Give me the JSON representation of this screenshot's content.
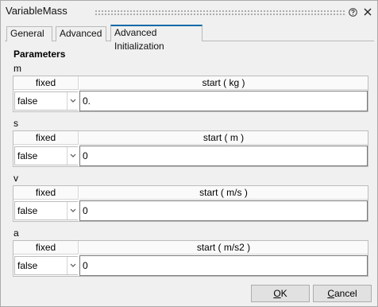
{
  "window": {
    "title": "VariableMass"
  },
  "tabs": [
    {
      "label": "General"
    },
    {
      "label": "Advanced"
    },
    {
      "label": "Advanced Initialization",
      "active": true
    }
  ],
  "section_title": "Parameters",
  "parameters": [
    {
      "name": "m",
      "fixed_header": "fixed",
      "start_header": "start ( kg )",
      "fixed_value": "false",
      "start_value": "0."
    },
    {
      "name": "s",
      "fixed_header": "fixed",
      "start_header": "start ( m )",
      "fixed_value": "false",
      "start_value": "0"
    },
    {
      "name": "v",
      "fixed_header": "fixed",
      "start_header": "start ( m/s )",
      "fixed_value": "false",
      "start_value": "0"
    },
    {
      "name": "a",
      "fixed_header": "fixed",
      "start_header": "start ( m/s2 )",
      "fixed_value": "false",
      "start_value": "0"
    }
  ],
  "buttons": {
    "ok_mnemonic": "O",
    "ok_rest": "K",
    "cancel_mnemonic": "C",
    "cancel_rest": "ancel"
  },
  "icons": {
    "help": "help-icon",
    "close": "close-icon",
    "dropdown": "chevron-down-icon"
  },
  "colors": {
    "active_tab_accent": "#0b6aa6"
  }
}
